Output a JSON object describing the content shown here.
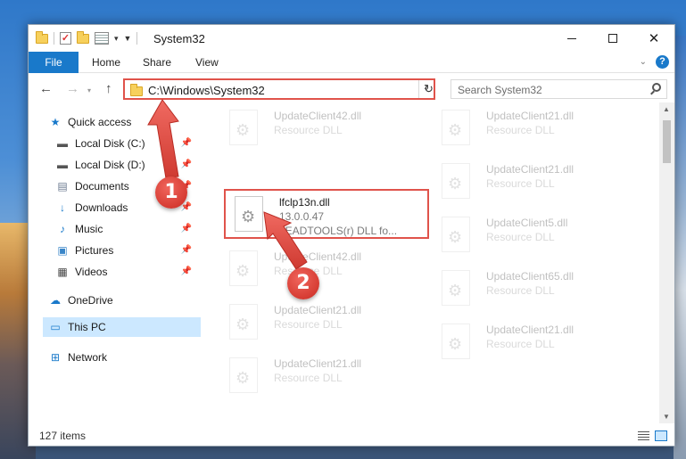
{
  "window": {
    "title": "System32"
  },
  "ribbon": {
    "tabs": [
      "File",
      "Home",
      "Share",
      "View"
    ],
    "help": "?"
  },
  "navigation": {
    "address_path": "C:\\Windows\\System32",
    "search_placeholder": "Search System32"
  },
  "sidebar": {
    "items": [
      {
        "label": "Quick access",
        "icon": "star-icon"
      },
      {
        "label": "Local Disk (C:)",
        "icon": "drive-icon",
        "pinned": true
      },
      {
        "label": "Local Disk (D:)",
        "icon": "drive-icon",
        "pinned": true
      },
      {
        "label": "Documents",
        "icon": "document-icon",
        "pinned": true
      },
      {
        "label": "Downloads",
        "icon": "download-icon",
        "pinned": true
      },
      {
        "label": "Music",
        "icon": "music-icon",
        "pinned": true
      },
      {
        "label": "Pictures",
        "icon": "pictures-icon",
        "pinned": true
      },
      {
        "label": "Videos",
        "icon": "video-icon",
        "pinned": true
      },
      {
        "label": "OneDrive",
        "icon": "cloud-icon"
      },
      {
        "label": "This PC",
        "icon": "computer-icon",
        "selected": true
      },
      {
        "label": "Network",
        "icon": "network-icon"
      }
    ]
  },
  "files": {
    "highlighted": {
      "name": "lfclp13n.dll",
      "version": "13.0.0.47",
      "description": "LEADTOOLS(r) DLL fo..."
    },
    "left_column": [
      {
        "name": "UpdateClient42.dll",
        "type": "Resource DLL"
      },
      {
        "name": "UpdateClient42.dll",
        "type": "Resource DLL"
      },
      {
        "name": "UpdateClient21.dll",
        "type": "Resource DLL"
      },
      {
        "name": "UpdateClient21.dll",
        "type": "Resource DLL"
      }
    ],
    "right_column": [
      {
        "name": "UpdateClient21.dll",
        "type": "Resource DLL"
      },
      {
        "name": "UpdateClient21.dll",
        "type": "Resource DLL"
      },
      {
        "name": "UpdateClient5.dll",
        "type": "Resource DLL"
      },
      {
        "name": "UpdateClient65.dll",
        "type": "Resource DLL"
      },
      {
        "name": "UpdateClient21.dll",
        "type": "Resource DLL"
      }
    ]
  },
  "status": {
    "item_count": "127 items"
  },
  "callouts": {
    "first": "1",
    "second": "2"
  },
  "colors": {
    "accent": "#1979ca",
    "highlight": "#e0534b",
    "selected_bg": "#cce8ff"
  }
}
